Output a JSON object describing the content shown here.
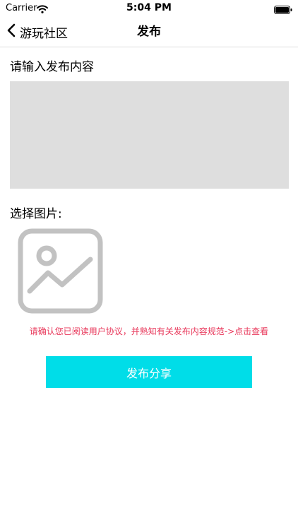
{
  "status_bar": {
    "carrier": "Carrier",
    "time": "5:04 PM"
  },
  "nav": {
    "back_label": "游玩社区",
    "title": "发布"
  },
  "form": {
    "content_label": "请输入发布内容",
    "content_value": "",
    "image_label": "选择图片:",
    "agreement_text": "请确认您已阅读用户协议，并熟知有关发布内容规范->点击查看",
    "submit_label": "发布分享"
  },
  "colors": {
    "accent": "#00dde8",
    "warning": "#e8375a",
    "input_bg": "#dedede"
  }
}
